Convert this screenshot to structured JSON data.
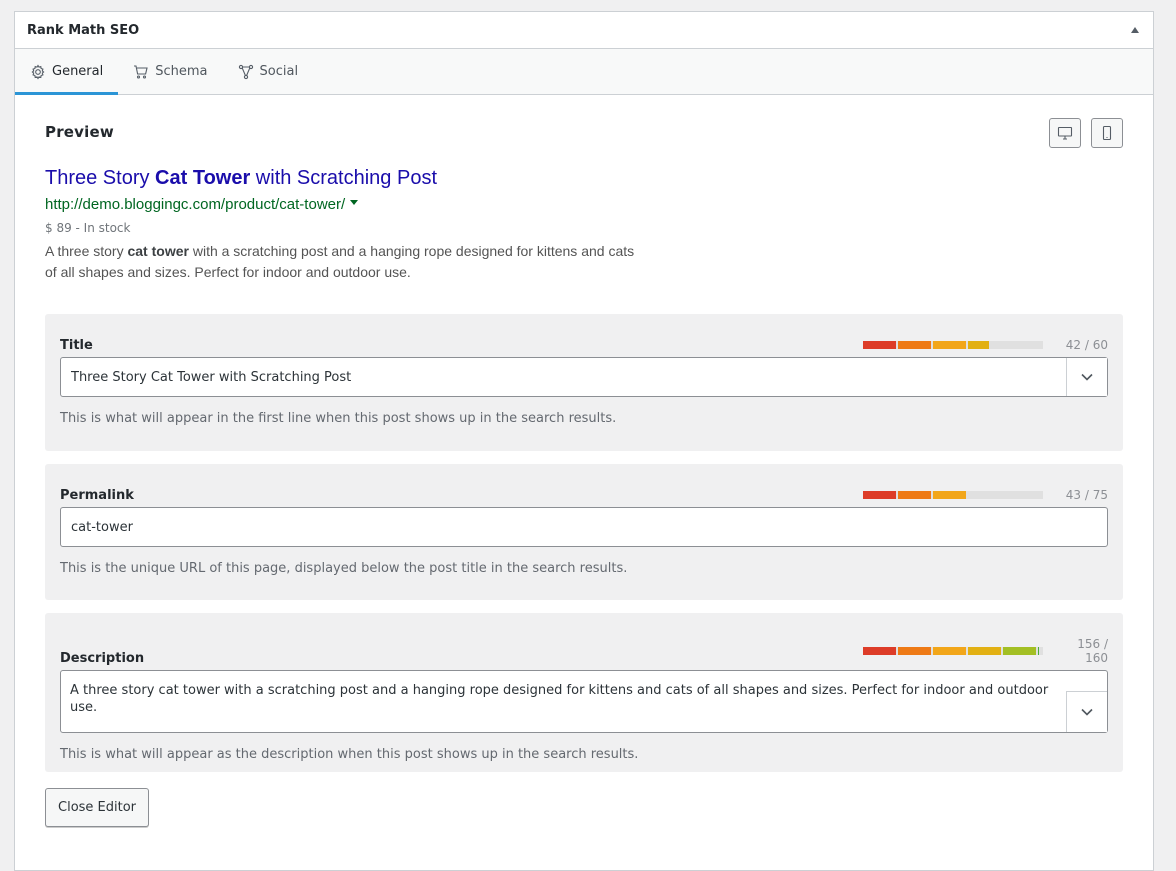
{
  "panel": {
    "title": "Rank Math SEO"
  },
  "tabs": [
    {
      "label": "General",
      "icon": "gear-icon",
      "active": true
    },
    {
      "label": "Schema",
      "icon": "cart-icon",
      "active": false
    },
    {
      "label": "Social",
      "icon": "share-icon",
      "active": false
    }
  ],
  "preview": {
    "label": "Preview",
    "title_before": "Three Story ",
    "title_bold": "Cat Tower",
    "title_after": " with Scratching Post",
    "url": "http://demo.bloggingc.com/product/cat-tower/",
    "meta": "$ 89 - In stock",
    "desc_before": "A three story ",
    "desc_bold": "cat tower",
    "desc_after": " with a scratching post and a hanging rope designed for kittens and cats of all shapes and sizes. Perfect for indoor and outdoor use."
  },
  "fields": {
    "title": {
      "label": "Title",
      "value": "Three Story Cat Tower with Scratching Post",
      "count": "42 / 60",
      "fraction": 0.7,
      "help": "This is what will appear in the first line when this post shows up in the search results."
    },
    "permalink": {
      "label": "Permalink",
      "value": "cat-tower",
      "count": "43 / 75",
      "fraction": 0.573,
      "help": "This is the unique URL of this page, displayed below the post title in the search results."
    },
    "description": {
      "label": "Description",
      "value": "A three story cat tower with a scratching post and a hanging rope designed for kittens and cats of all shapes and sizes. Perfect for indoor and outdoor use.",
      "count": "156 / 160",
      "fraction": 0.975,
      "help": "This is what will appear as the description when this post shows up in the search results."
    }
  },
  "close_button": "Close Editor",
  "colors": {
    "accent": "#2b95d6",
    "serp_title": "#1a0dab",
    "serp_url": "#006621",
    "meter_segments": [
      "#dd3c28",
      "#ee7a16",
      "#f2a61a",
      "#e2b013",
      "#a3bf24",
      "#4dad3c"
    ]
  }
}
